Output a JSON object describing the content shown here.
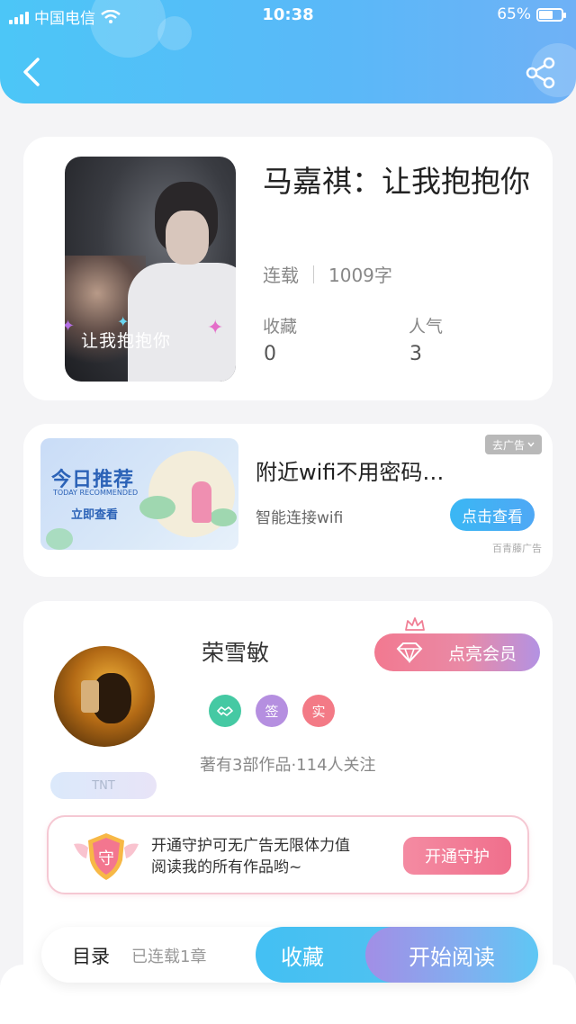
{
  "status_bar": {
    "carrier": "中国电信",
    "time": "10:38",
    "battery": "65%",
    "battery_level": 0.65
  },
  "header": {
    "back_icon": "chevron-left-icon",
    "share_icon": "share-icon"
  },
  "book": {
    "title": "马嘉祺：让我抱抱你",
    "cover_text": "让我抱抱你",
    "status": "连载",
    "word_count": "1009字",
    "stats": [
      {
        "label": "收藏",
        "value": "0"
      },
      {
        "label": "人气",
        "value": "3"
      }
    ]
  },
  "ad": {
    "banner_title": "今日推荐",
    "banner_subtitle": "TODAY RECOMMENDED",
    "banner_button": "立即查看",
    "title": "附近wifi不用密码…",
    "description": "智能连接wifi",
    "close_label": "去广告",
    "button": "点击查看",
    "source": "百青藤广告"
  },
  "author": {
    "name": "荣雪敏",
    "tag": "TNT",
    "badges": [
      {
        "text": "",
        "color": "#45c9a3",
        "icon": "handshake-icon"
      },
      {
        "text": "签",
        "color": "#b58fe0"
      },
      {
        "text": "实",
        "color": "#f37a86"
      }
    ],
    "stats": "著有3部作品·114人关注",
    "vip_button": "点亮会员",
    "guard": {
      "shield_text": "守",
      "line1": "开通守护可无广告无限体力值",
      "line2": "阅读我的所有作品哟~",
      "button": "开通守护"
    }
  },
  "bottom_bar": {
    "toc": "目录",
    "chapters": "已连载1章",
    "favorite": "收藏",
    "start_reading": "开始阅读"
  },
  "colors": {
    "header": "#4cc6f7",
    "accent_pink": "#f06f8c",
    "accent_blue": "#3ab7f4"
  }
}
